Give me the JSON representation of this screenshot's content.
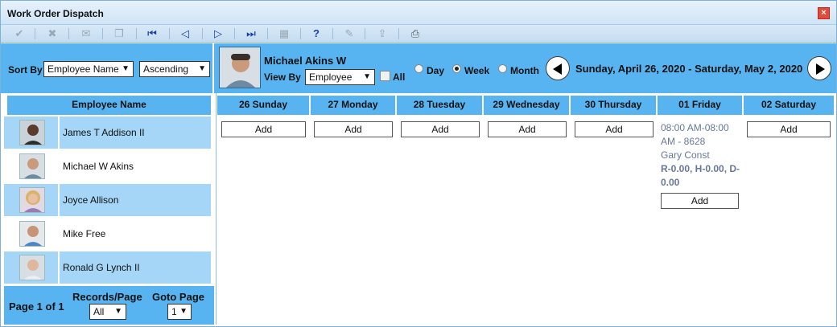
{
  "window": {
    "title": "Work Order Dispatch",
    "close_label": "×"
  },
  "toolbar": {
    "buttons": [
      {
        "icon": "check-icon",
        "glyph": "✔"
      },
      {
        "icon": "cancel-icon",
        "glyph": "✖"
      },
      {
        "icon": "mail-icon",
        "glyph": "✉"
      },
      {
        "icon": "copy-icon",
        "glyph": "❐"
      },
      {
        "icon": "first-icon",
        "glyph": "⏮"
      },
      {
        "icon": "prev-icon",
        "glyph": "◁"
      },
      {
        "icon": "next-icon",
        "glyph": "▷"
      },
      {
        "icon": "last-icon",
        "glyph": "⏭"
      },
      {
        "icon": "calendar-icon",
        "glyph": "▦"
      },
      {
        "icon": "help-icon",
        "glyph": "?"
      },
      {
        "icon": "note-icon",
        "glyph": "✎"
      },
      {
        "icon": "export-icon",
        "glyph": "⇪"
      },
      {
        "icon": "print-icon",
        "glyph": "⎙"
      }
    ]
  },
  "sort": {
    "label": "Sort By",
    "field": "Employee Name",
    "order": "Ascending"
  },
  "selected_employee": {
    "name": "Michael Akins W",
    "view_by_label": "View By",
    "view_by": "Employee",
    "all_label": "All"
  },
  "view_modes": [
    {
      "label": "Day"
    },
    {
      "label": "Week"
    },
    {
      "label": "Month"
    }
  ],
  "date_range": "Sunday, April 26, 2020 - Saturday, May 2, 2020",
  "employee_header": "Employee Name",
  "employees": [
    {
      "name": "James T Addison II"
    },
    {
      "name": "Michael W Akins"
    },
    {
      "name": "Joyce Allison"
    },
    {
      "name": "Mike Free"
    },
    {
      "name": "Ronald G Lynch II"
    }
  ],
  "days": [
    {
      "label": "26 Sunday"
    },
    {
      "label": "27 Monday"
    },
    {
      "label": "28 Tuesday"
    },
    {
      "label": "29 Wednesday"
    },
    {
      "label": "30 Thursday"
    },
    {
      "label": "01 Friday"
    },
    {
      "label": "02 Saturday"
    }
  ],
  "add_label": "Add",
  "event": {
    "time": "08:00 AM-08:00 AM - 8628",
    "customer": "Gary Const",
    "hours": "R-0.00, H-0.00, D-0.00"
  },
  "footer": {
    "page_text": "Page 1 of 1",
    "records_label": "Records/Page",
    "records_value": "All",
    "goto_label": "Goto Page",
    "goto_value": "1"
  },
  "colors": {
    "header_blue": "#58b4f0",
    "row_alt": "#a5d6f7"
  }
}
